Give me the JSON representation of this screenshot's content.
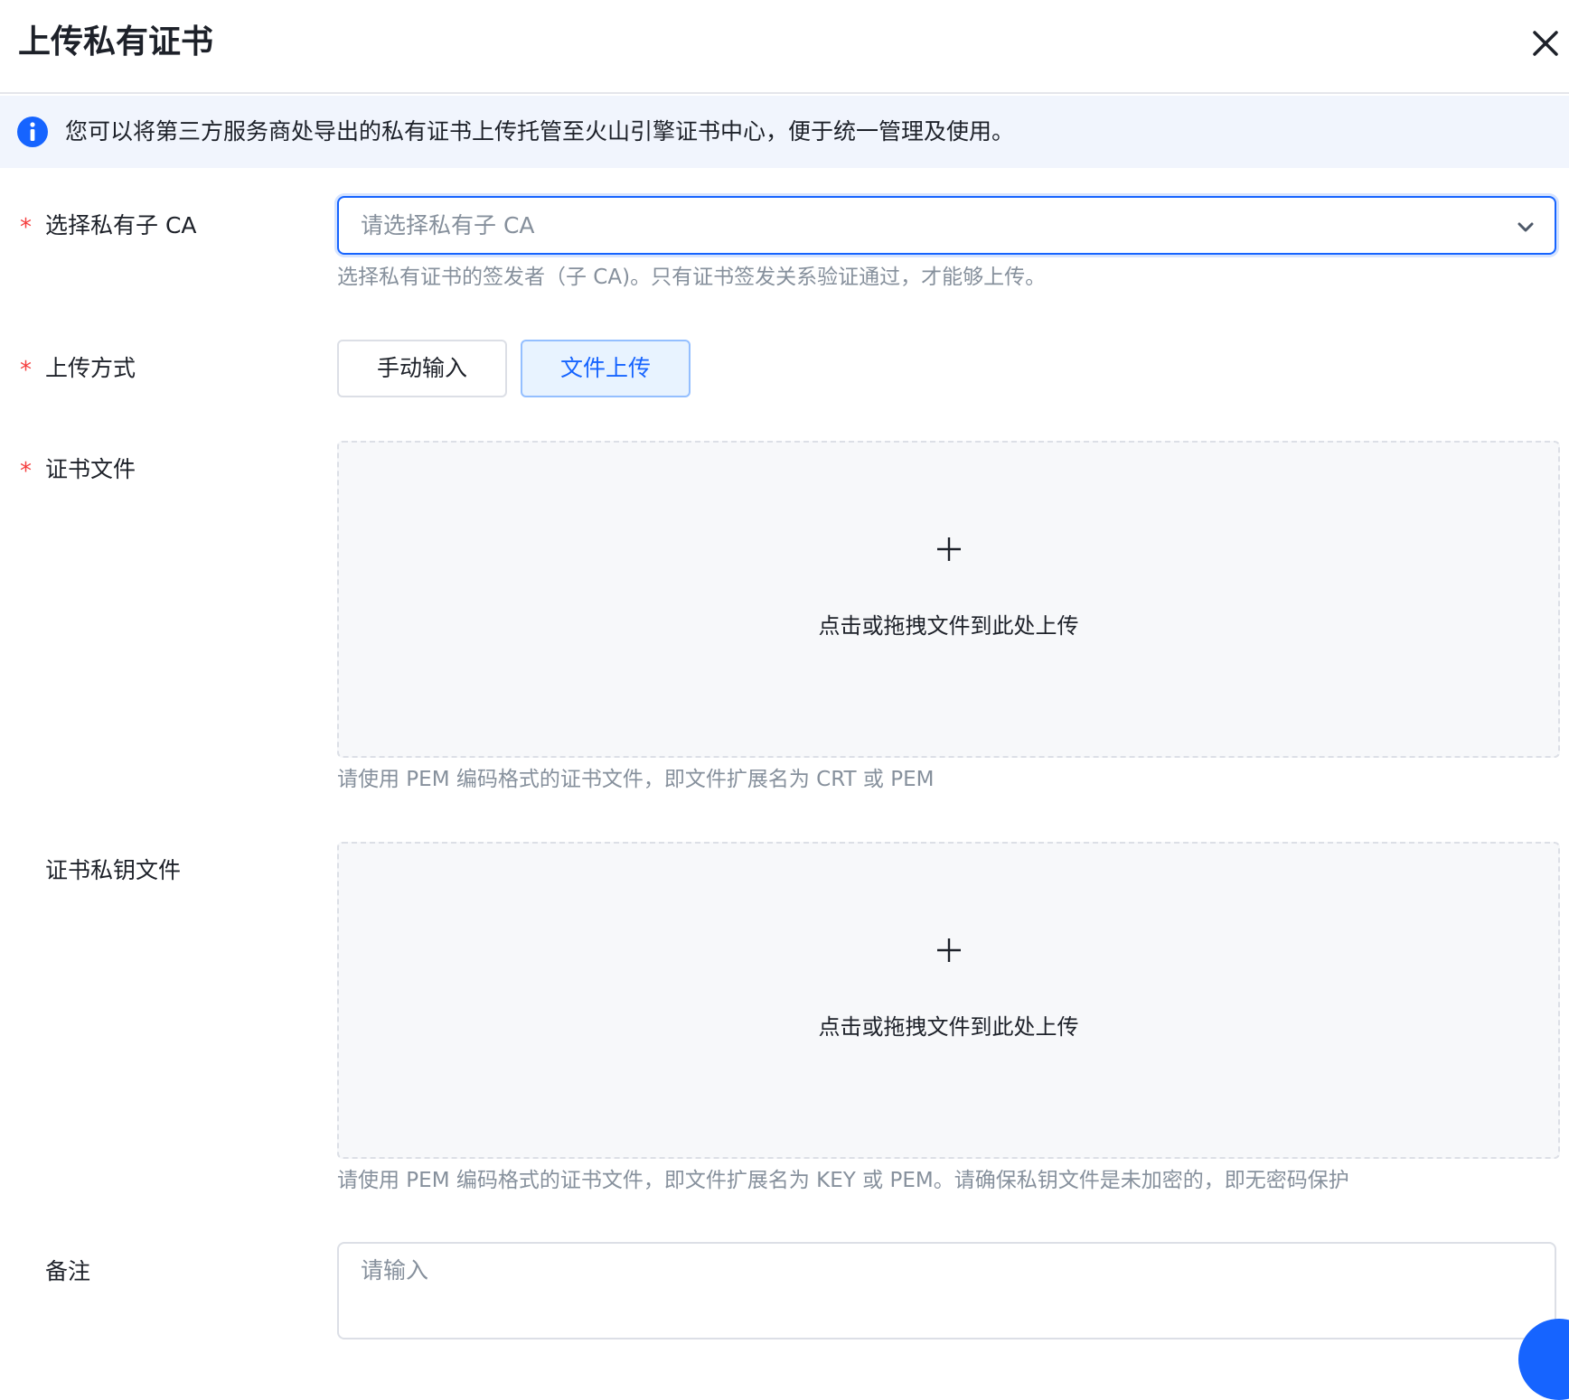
{
  "dialog": {
    "title": "上传私有证书"
  },
  "notice": {
    "text": "您可以将第三方服务商处导出的私有证书上传托管至火山引擎证书中心，便于统一管理及使用。"
  },
  "form": {
    "required_mark": "*",
    "ca": {
      "label": "选择私有子 CA",
      "placeholder": "请选择私有子 CA",
      "help": "选择私有证书的签发者（子 CA)。只有证书签发关系验证通过，才能够上传。"
    },
    "upload_method": {
      "label": "上传方式",
      "options": [
        "手动输入",
        "文件上传"
      ],
      "selected": "文件上传"
    },
    "cert_file": {
      "label": "证书文件",
      "drop_text": "点击或拖拽文件到此处上传",
      "help": "请使用 PEM 编码格式的证书文件，即文件扩展名为 CRT 或 PEM"
    },
    "key_file": {
      "label": "证书私钥文件",
      "drop_text": "点击或拖拽文件到此处上传",
      "help": "请使用 PEM 编码格式的证书文件，即文件扩展名为 KEY 或 PEM。请确保私钥文件是未加密的，即无密码保护"
    },
    "remark": {
      "label": "备注",
      "placeholder": "请输入"
    }
  },
  "colors": {
    "accent": "#1664ff",
    "required": "#f53f3f",
    "notice_bg": "#f1f5fd",
    "dropzone_bg": "#f7f8fa"
  }
}
